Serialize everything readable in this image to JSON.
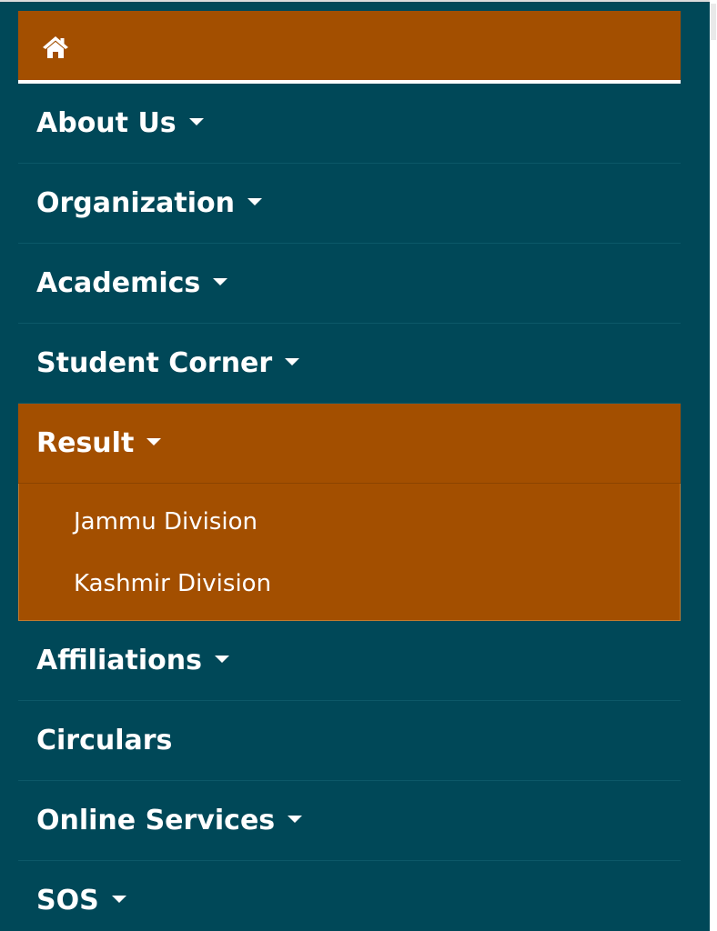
{
  "nav": {
    "home_icon": "home-icon",
    "items": [
      {
        "label": "About Us",
        "has_dropdown": true
      },
      {
        "label": "Organization",
        "has_dropdown": true
      },
      {
        "label": "Academics",
        "has_dropdown": true
      },
      {
        "label": "Student Corner",
        "has_dropdown": true
      },
      {
        "label": "Result",
        "has_dropdown": true,
        "expanded": true
      },
      {
        "label": "Affiliations",
        "has_dropdown": true
      },
      {
        "label": "Circulars",
        "has_dropdown": false
      },
      {
        "label": "Online Services",
        "has_dropdown": true
      },
      {
        "label": "SOS",
        "has_dropdown": true
      }
    ],
    "result_submenu": [
      {
        "label": "Jammu Division"
      },
      {
        "label": "Kashmir Division"
      }
    ]
  },
  "colors": {
    "drawer_bg": "#004858",
    "accent": "#a34f00",
    "text": "#ffffff",
    "divider": "#0c5868"
  }
}
